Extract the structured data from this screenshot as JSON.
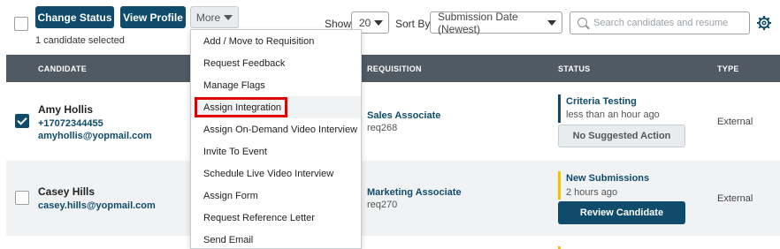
{
  "toolbar": {
    "change_status_label": "Change Status",
    "view_profile_label": "View Profile",
    "more_label": "More",
    "selected_count": "1 candidate selected",
    "show_label": "Show",
    "show_value": "20",
    "sort_label": "Sort By",
    "sort_value": "Submission Date (Newest)",
    "search_placeholder": "Search candidates and resume"
  },
  "table": {
    "headers": {
      "candidate": "CANDIDATE",
      "requisition": "REQUISITION",
      "status": "STATUS",
      "type": "TYPE"
    },
    "rows": [
      {
        "checked": true,
        "name": "Amy Hollis",
        "phone": "+17072344455",
        "email": "amyhollis@yopmail.com",
        "requisition_title": "Sales Associate",
        "requisition_id": "req268",
        "status": "Criteria Testing",
        "status_time": "less than an hour ago",
        "status_color": "#0f4c6b",
        "action": "No Suggested Action",
        "type": "External"
      },
      {
        "checked": false,
        "name": "Casey Hills",
        "email": "casey.hills@yopmail.com",
        "requisition_title": "Marketing Associate",
        "requisition_id": "req270",
        "status": "New Submissions",
        "status_time": "2 hours ago",
        "status_color": "#f2c200",
        "action": "Review Candidate",
        "type": "External"
      }
    ]
  },
  "more_menu": {
    "items": [
      "Add / Move to Requisition",
      "Request Feedback",
      "Manage Flags",
      "Assign Integration",
      "Assign On-Demand Video Interview",
      "Invite To Event",
      "Schedule Live Video Interview",
      "Assign Form",
      "Request Reference Letter",
      "Send Email"
    ],
    "highlighted_item": "Assign Integration"
  },
  "colors": {
    "primary": "#0f4c6b",
    "header_bg": "#505a63",
    "highlight": "#e00000"
  },
  "icons": [
    "search-icon",
    "gear-icon",
    "chevron-down-icon",
    "checkbox-icon"
  ]
}
